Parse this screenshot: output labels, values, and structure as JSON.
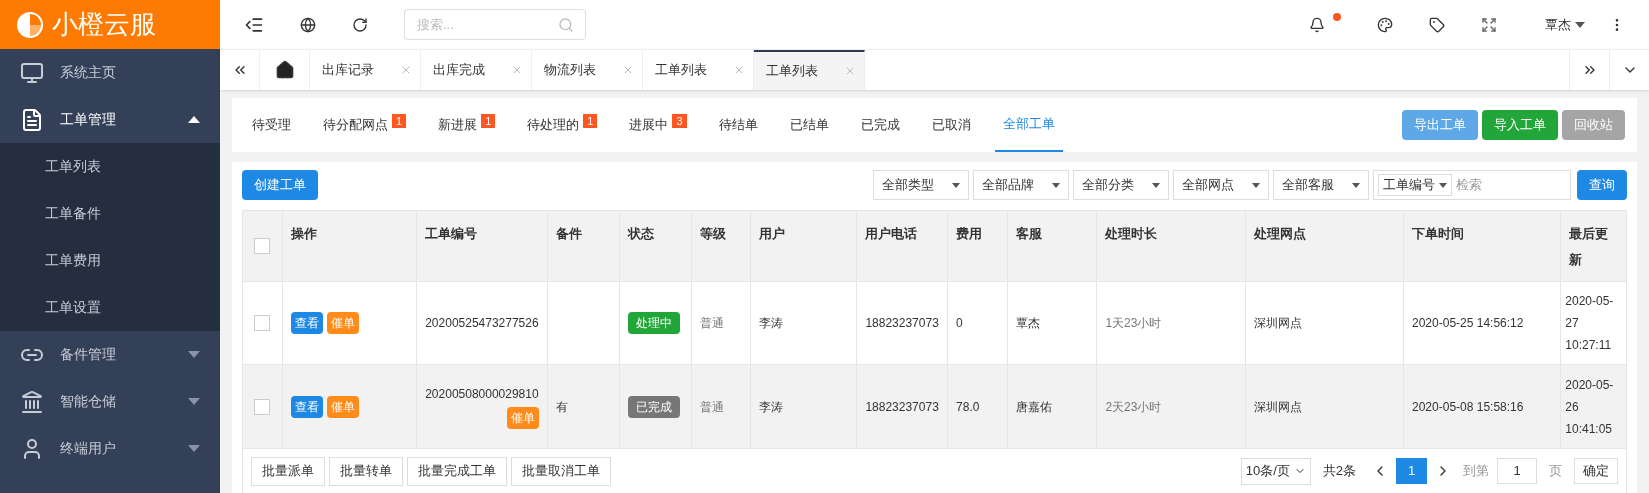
{
  "logo": {
    "text": "小橙云服"
  },
  "header": {
    "search": {
      "placeholder": "搜索..."
    },
    "notification": true,
    "user": "覃杰"
  },
  "sidebar": {
    "items": [
      {
        "label": "系统主页",
        "kind": "link"
      },
      {
        "label": "工单管理",
        "kind": "group",
        "expanded": true,
        "children": [
          {
            "label": "工单列表",
            "selected": false
          },
          {
            "label": "工单备件",
            "selected": false
          },
          {
            "label": "工单费用",
            "selected": false
          },
          {
            "label": "工单设置",
            "selected": false
          }
        ]
      },
      {
        "label": "备件管理",
        "kind": "group",
        "expanded": false
      },
      {
        "label": "智能仓储",
        "kind": "group",
        "expanded": false
      },
      {
        "label": "终端用户",
        "kind": "group",
        "expanded": false
      }
    ]
  },
  "page_tabs": [
    {
      "label": "出库记录",
      "selected": false
    },
    {
      "label": "出库完成",
      "selected": false
    },
    {
      "label": "物流列表",
      "selected": false
    },
    {
      "label": "工单列表",
      "selected": false
    },
    {
      "label": "工单列表",
      "selected": true
    }
  ],
  "status_tabs": [
    {
      "label": "待受理",
      "selected": false
    },
    {
      "label": "待分配网点",
      "count": "1",
      "selected": false
    },
    {
      "label": "新进展",
      "count": "1",
      "selected": false
    },
    {
      "label": "待处理的",
      "count": "1",
      "selected": false
    },
    {
      "label": "进展中",
      "count": "3",
      "selected": false
    },
    {
      "label": "待结单",
      "selected": false
    },
    {
      "label": "已结单",
      "selected": false
    },
    {
      "label": "已完成",
      "selected": false
    },
    {
      "label": "已取消",
      "selected": false
    },
    {
      "label": "全部工单",
      "selected": true
    }
  ],
  "top_buttons": [
    {
      "label": "导出工单",
      "kind": "light"
    },
    {
      "label": "导入工单",
      "kind": "success"
    },
    {
      "label": "回收站",
      "kind": "muted"
    }
  ],
  "create_button": "创建工单",
  "filters": [
    "全部类型",
    "全部品牌",
    "全部分类",
    "全部网点",
    "全部客服"
  ],
  "search": {
    "field": "工单编号",
    "placeholder": "检索",
    "button": "查询"
  },
  "table": {
    "select_all": {
      "checked": false
    },
    "columns": [
      "操作",
      "工单编号",
      "备件",
      "状态",
      "等级",
      "用户",
      "用户电话",
      "费用",
      "客服",
      "处理时长",
      "处理网点",
      "下单时间",
      "最后更新"
    ],
    "rows": [
      {
        "checked": false,
        "actions": [
          "查看",
          "催单"
        ],
        "id": "20200525473277526",
        "urge": null,
        "parts": "",
        "status": {
          "label": "处理中",
          "kind": "processing"
        },
        "level": "普通",
        "user": "李涛",
        "phone": "18823237073",
        "fee": "0",
        "agent": "覃杰",
        "duration": "1天23小时",
        "site": "深圳网点",
        "created": "2020-05-25 14:56:12",
        "updated": "2020-05-27 10:27:11"
      },
      {
        "checked": false,
        "actions": [
          "查看",
          "催单"
        ],
        "id": "20200508000029810",
        "urge": "催单",
        "parts": "有",
        "status": {
          "label": "已完成",
          "kind": "done"
        },
        "level": "普通",
        "user": "李涛",
        "phone": "18823237073",
        "fee": "78.0",
        "agent": "唐嘉佑",
        "duration": "2天23小时",
        "site": "深圳网点",
        "created": "2020-05-08 15:58:16",
        "updated": "2020-05-26 10:41:05"
      }
    ]
  },
  "bulk_buttons": [
    "批量派单",
    "批量转单",
    "批量完成工单",
    "批量取消工单"
  ],
  "pagination": {
    "page_size": "10条/页",
    "total": "共2条",
    "pages": [
      {
        "label": "1",
        "selected": true
      }
    ],
    "goto_label": "到第",
    "goto_value": "1",
    "page_unit": "页",
    "confirm": "确定"
  }
}
